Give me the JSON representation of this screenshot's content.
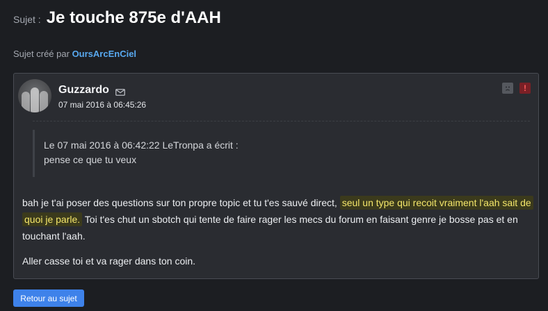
{
  "topic": {
    "prefix": "Sujet :",
    "title": "Je touche 875e d'AAH",
    "created_by_label": "Sujet créé par",
    "created_by_author": "OursArcEnCiel"
  },
  "post": {
    "author": "Guzzardo",
    "date": "07 mai 2016 à 06:45:26",
    "icons": [
      "mail-icon",
      "mood-icon",
      "alert-icon"
    ],
    "alert_symbol": "!",
    "quote": {
      "header": "Le 07 mai 2016 à 06:42:22 LeTronpa a écrit :",
      "text": "pense ce que tu veux"
    },
    "paragraph1_before": "bah je t'ai poser des questions sur ton propre topic et tu t'es sauvé direct, ",
    "paragraph1_highlight": "seul un type qui recoit vraiment l'aah sait de quoi je parle.",
    "paragraph1_after": " Toi t'es chut un sbotch qui tente de faire rager les mecs du forum en faisant genre je bosse pas et en touchant l'aah.",
    "paragraph2": "Aller casse toi et va rager dans ton coin."
  },
  "footer": {
    "back_button": "Retour au sujet"
  },
  "colors": {
    "background": "#1c1e22",
    "panel": "#2a2c31",
    "link": "#58a9f0",
    "highlight_text": "#f4e66a",
    "highlight_bg": "#3b3a1c",
    "button": "#3e82ea",
    "alert": "#7a2026"
  }
}
